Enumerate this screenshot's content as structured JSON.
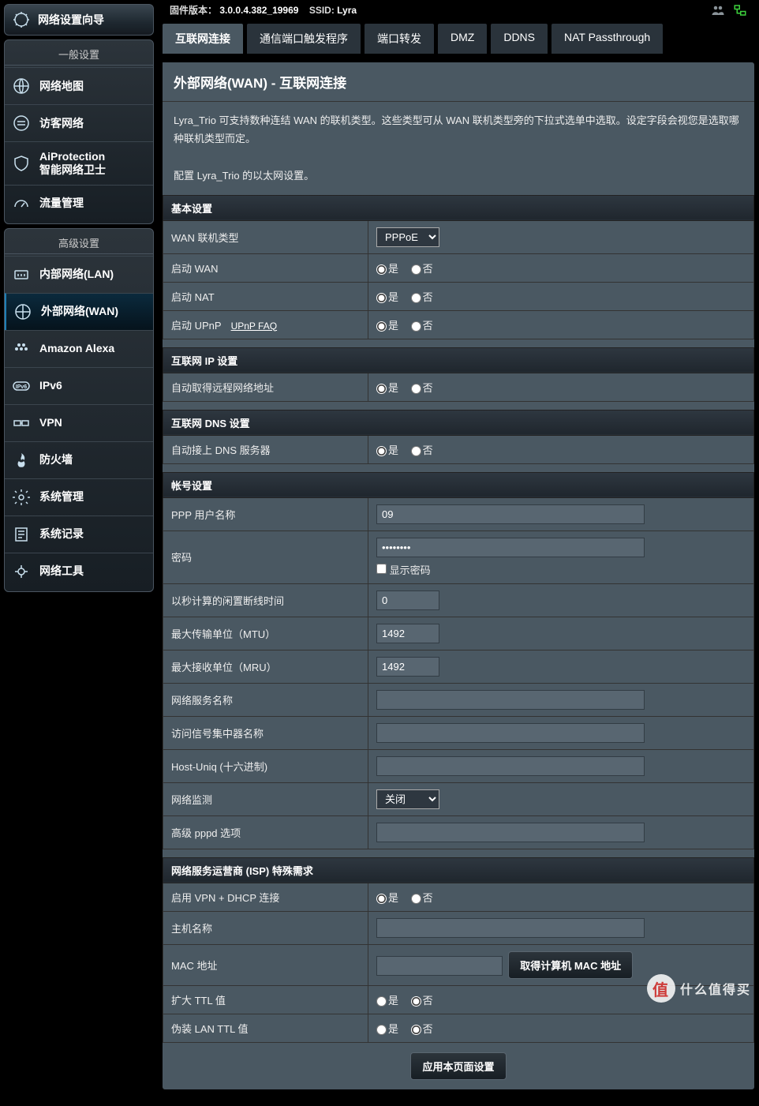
{
  "status": {
    "fw_label": "固件版本：",
    "fw_ver": "3.0.0.4.382_19969",
    "ssid_label": "SSID:",
    "ssid": "Lyra"
  },
  "wizard": {
    "label": "网络设置向导"
  },
  "section_general": "一般设置",
  "general": [
    {
      "id": "netmap",
      "label": "网络地图"
    },
    {
      "id": "guest",
      "label": "访客网络"
    },
    {
      "id": "aiprot",
      "label": "AiProtection\n智能网络卫士"
    },
    {
      "id": "traffic",
      "label": "流量管理"
    }
  ],
  "section_adv": "高级设置",
  "adv": [
    {
      "id": "lan",
      "label": "内部网络(LAN)"
    },
    {
      "id": "wan",
      "label": "外部网络(WAN)",
      "active": true
    },
    {
      "id": "alexa",
      "label": "Amazon Alexa"
    },
    {
      "id": "ipv6",
      "label": "IPv6"
    },
    {
      "id": "vpn",
      "label": "VPN"
    },
    {
      "id": "firewall",
      "label": "防火墙"
    },
    {
      "id": "admin",
      "label": "系统管理"
    },
    {
      "id": "syslog",
      "label": "系统记录"
    },
    {
      "id": "tools",
      "label": "网络工具"
    }
  ],
  "tabs": [
    "互联网连接",
    "通信端口触发程序",
    "端口转发",
    "DMZ",
    "DDNS",
    "NAT Passthrough"
  ],
  "active_tab": 0,
  "page": {
    "title": "外部网络(WAN) - 互联网连接",
    "desc1": "Lyra_Trio 可支持数种连结 WAN 的联机类型。这些类型可从 WAN 联机类型旁的下拉式选单中选取。设定字段会视您是选取哪种联机类型而定。",
    "desc2": "配置 Lyra_Trio 的以太网设置。"
  },
  "sections": {
    "basic": "基本设置",
    "ip": "互联网 IP 设置",
    "dns": "互联网 DNS 设置",
    "account": "帐号设置",
    "isp": "网络服务运营商 (ISP) 特殊需求"
  },
  "fields": {
    "wan_type": "WAN 联机类型",
    "wan_type_val": "PPPoE",
    "en_wan": "启动 WAN",
    "en_nat": "启动 NAT",
    "en_upnp": "启动 UPnP",
    "upnp_faq": "UPnP  FAQ",
    "auto_ip": "自动取得远程网络地址",
    "auto_dns": "自动接上 DNS 服务器",
    "ppp_user": "PPP 用户名称",
    "ppp_user_val": "09",
    "password": "密码",
    "show_pw": "显示密码",
    "idle": "以秒计算的闲置断线时间",
    "idle_val": "0",
    "mtu": "最大传输单位（MTU）",
    "mtu_val": "1492",
    "mru": "最大接收单位（MRU）",
    "mru_val": "1492",
    "svc_name": "网络服务名称",
    "concentrator": "访问信号集中器名称",
    "host_uniq": "Host-Uniq (十六进制)",
    "net_monitor": "网络监测",
    "net_monitor_val": "关闭",
    "adv_pppd": "高级 pppd 选项",
    "vpn_dhcp": "启用 VPN + DHCP 连接",
    "hostname": "主机名称",
    "mac": "MAC 地址",
    "mac_btn": "取得计算机 MAC 地址",
    "ext_ttl": "扩大 TTL 值",
    "fake_ttl": "伪装 LAN TTL 值"
  },
  "radio": {
    "yes": "是",
    "no": "否"
  },
  "apply_btn": "应用本页面设置",
  "watermark": "什么值得买"
}
